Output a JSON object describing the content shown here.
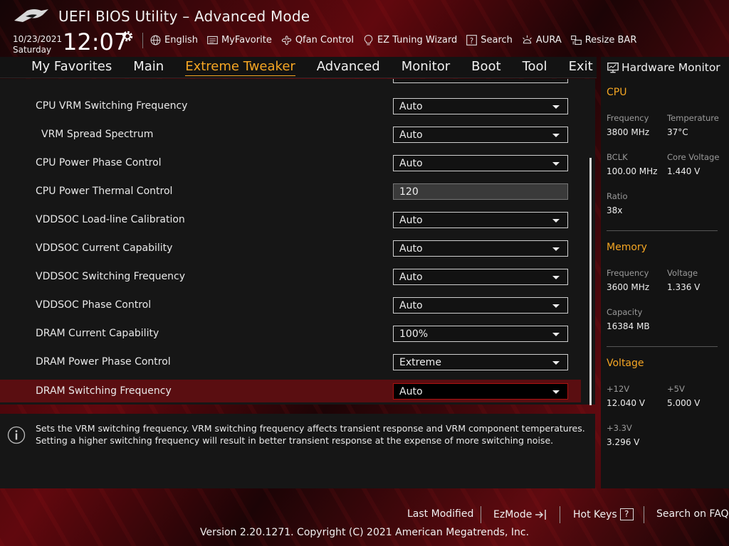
{
  "header": {
    "title": "UEFI BIOS Utility – Advanced Mode",
    "date": "10/23/2021",
    "day": "Saturday",
    "time": "12:07",
    "tools": [
      {
        "label": "English",
        "icon": "globe-icon"
      },
      {
        "label": "MyFavorite",
        "icon": "favorite-list-icon"
      },
      {
        "label": "Qfan Control",
        "icon": "fan-icon"
      },
      {
        "label": "EZ Tuning Wizard",
        "icon": "lightbulb-icon"
      },
      {
        "label": "Search",
        "icon": "help-search-icon"
      },
      {
        "label": "AURA",
        "icon": "aura-light-icon"
      },
      {
        "label": "Resize BAR",
        "icon": "resize-bar-icon"
      }
    ]
  },
  "nav": {
    "tabs": [
      "My Favorites",
      "Main",
      "Extreme Tweaker",
      "Advanced",
      "Monitor",
      "Boot",
      "Tool",
      "Exit"
    ],
    "active": "Extreme Tweaker"
  },
  "settings": [
    {
      "label": "CPU VRM Switching Frequency",
      "value": "Auto",
      "type": "dropdown"
    },
    {
      "label": "VRM Spread Spectrum",
      "value": "Auto",
      "type": "dropdown"
    },
    {
      "label": "CPU Power Phase Control",
      "value": "Auto",
      "type": "dropdown"
    },
    {
      "label": "CPU Power Thermal Control",
      "value": "120",
      "type": "field"
    },
    {
      "label": "VDDSOC Load-line Calibration",
      "value": "Auto",
      "type": "dropdown"
    },
    {
      "label": "VDDSOC Current Capability",
      "value": "Auto",
      "type": "dropdown"
    },
    {
      "label": "VDDSOC Switching Frequency",
      "value": "Auto",
      "type": "dropdown"
    },
    {
      "label": "VDDSOC Phase Control",
      "value": "Auto",
      "type": "dropdown"
    },
    {
      "label": "DRAM Current Capability",
      "value": "100%",
      "type": "dropdown"
    },
    {
      "label": "DRAM Power Phase Control",
      "value": "Extreme",
      "type": "dropdown"
    },
    {
      "label": "DRAM Switching Frequency",
      "value": "Auto",
      "type": "dropdown",
      "selected": true
    }
  ],
  "help": {
    "text": "Sets the VRM switching frequency.  VRM switching frequency affects transient response and VRM component temperatures. Setting a higher switching frequency will result in better transient response at the expense of more switching noise."
  },
  "monitor": {
    "title": "Hardware Monitor",
    "cpu": {
      "heading": "CPU",
      "frequency_label": "Frequency",
      "frequency": "3800 MHz",
      "temperature_label": "Temperature",
      "temperature": "37°C",
      "bclk_label": "BCLK",
      "bclk": "100.00 MHz",
      "core_voltage_label": "Core Voltage",
      "core_voltage": "1.440 V",
      "ratio_label": "Ratio",
      "ratio": "38x"
    },
    "memory": {
      "heading": "Memory",
      "frequency_label": "Frequency",
      "frequency": "3600 MHz",
      "voltage_label": "Voltage",
      "voltage": "1.336 V",
      "capacity_label": "Capacity",
      "capacity": "16384 MB"
    },
    "voltage": {
      "heading": "Voltage",
      "v12_label": "+12V",
      "v12": "12.040 V",
      "v5_label": "+5V",
      "v5": "5.000 V",
      "v33_label": "+3.3V",
      "v33": "3.296 V"
    }
  },
  "footer": {
    "last_modified": "Last Modified",
    "ezmode": "EzMode",
    "hotkeys": "Hot Keys",
    "hotkeys_key": "?",
    "search_faq": "Search on FAQ",
    "copyright": "Version 2.20.1271. Copyright (C) 2021 American Megatrends, Inc."
  },
  "colors": {
    "accent": "#f5a623",
    "selected_row": "#5a0e11",
    "panel": "#161616"
  }
}
